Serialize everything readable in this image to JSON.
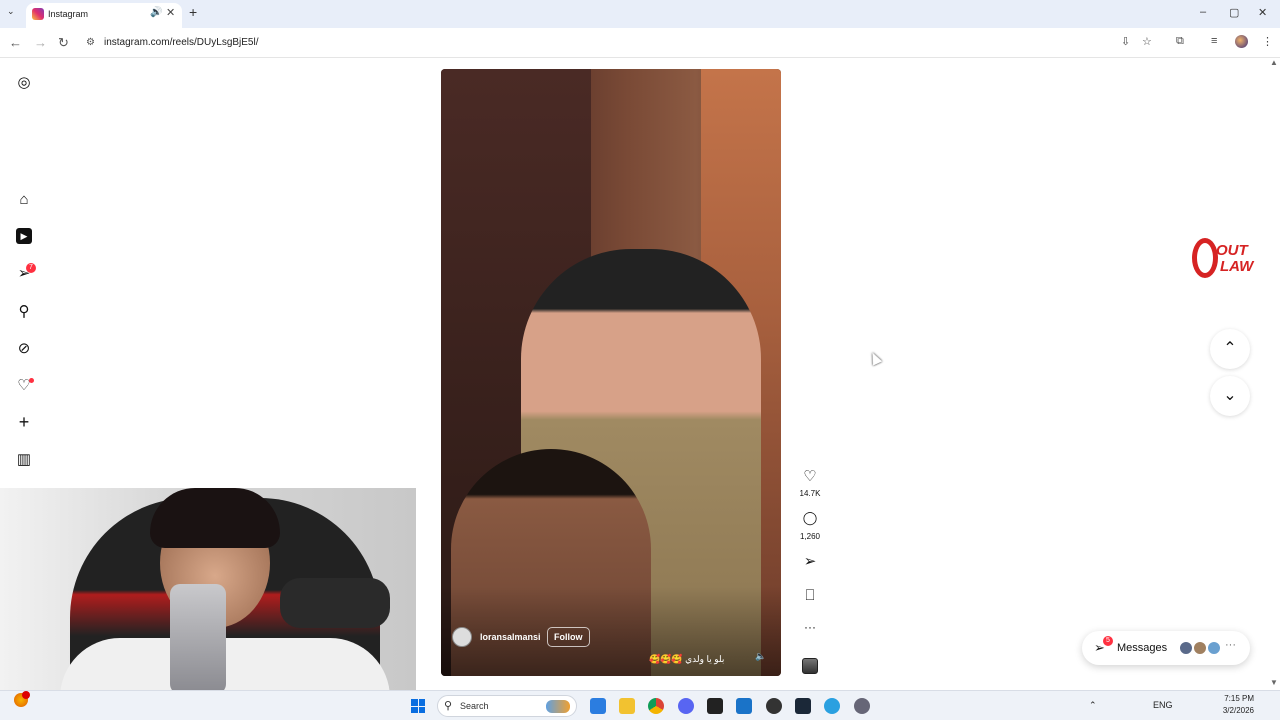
{
  "browser": {
    "tab_title": "Instagram",
    "url": "instagram.com/reels/DUyLsgBjE5l/",
    "new_tab_symbol": "+",
    "tab_list_symbol": "⌄",
    "tab_audio_symbol": "🔊",
    "tab_close_symbol": "✕",
    "nav": {
      "back": "←",
      "forward": "→",
      "reload": "↻",
      "site_info": "⚙"
    },
    "window_controls": {
      "minimize": "–",
      "maximize": "▢",
      "close": "✕"
    },
    "toolbar": {
      "install": "⇩",
      "star": "☆",
      "extensions": "⧉",
      "media": "≡",
      "menu": "⋮"
    }
  },
  "left_nav": {
    "icons": {
      "logo": "instagram-icon",
      "home": "home-icon",
      "reels": "reels-icon",
      "messages": "send-icon",
      "search": "search-icon",
      "explore": "compass-icon",
      "notifications": "heart-icon",
      "create": "plus-icon",
      "dashboard": "chart-icon",
      "profile": "avatar",
      "more": "menu-icon",
      "also_from_meta": "grid-icon"
    },
    "glyphs": {
      "logo": "◎",
      "home": "⌂",
      "reels": "▶",
      "messages": "➢",
      "search": "⚲",
      "explore": "⊘",
      "notifications": "♡",
      "create": "+",
      "dashboard": "▥",
      "more": "☰",
      "also_from_meta": "⊞"
    },
    "messages_badge": "7"
  },
  "reel": {
    "username": "loransalmansi",
    "follow_label": "Follow",
    "caption": "بلو يا ولدي 🥰🥰🥰",
    "mute_glyph": "🔈"
  },
  "actions": {
    "like_glyph": "♡",
    "likes": "14.7K",
    "comment_glyph": "◯",
    "comments": "1,260",
    "share_glyph": "➢",
    "save_glyph": "⎕",
    "more_glyph": "···"
  },
  "navigation": {
    "prev_glyph": "⌃",
    "next_glyph": "⌄"
  },
  "overlay_logo": {
    "line1": "OUT",
    "line2": "LAW"
  },
  "messages_pill": {
    "label": "Messages",
    "badge": "5",
    "icon_glyph": "➢",
    "more": "···"
  },
  "taskbar": {
    "search_placeholder": "Search",
    "search_glyph": "⚲",
    "language": "ENG",
    "time": "7:15 PM",
    "date": "3/2/2026",
    "tray_up": "⌃"
  },
  "colors": {
    "accent_red": "#ff3040",
    "logo_red": "#d62323",
    "windows_blue": "#0a6ee0"
  }
}
